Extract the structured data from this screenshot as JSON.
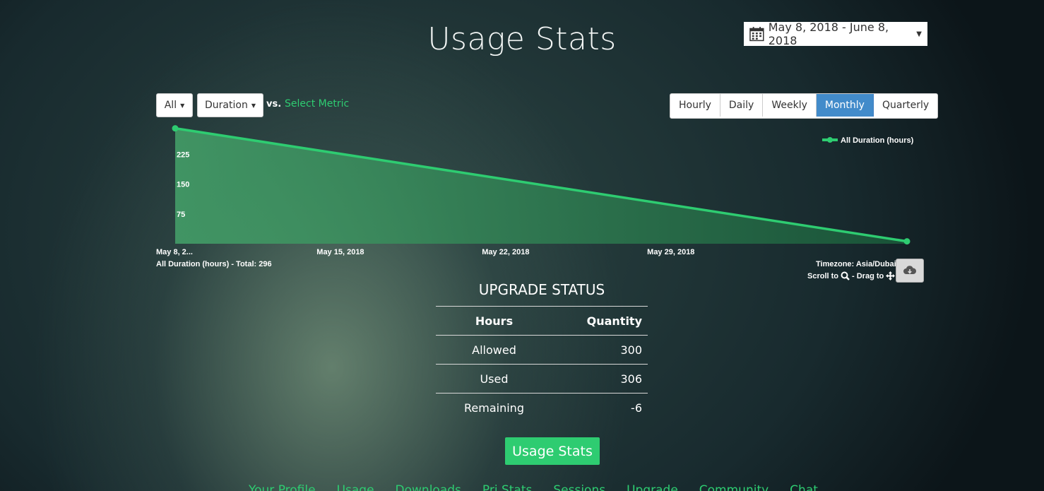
{
  "header": {
    "title": "Usage Stats",
    "date_range": "May 8, 2018 - June 8, 2018"
  },
  "filters": {
    "all_label": "All",
    "duration_label": "Duration",
    "vs_label": "vs.",
    "select_metric": "Select Metric"
  },
  "periods": [
    {
      "label": "Hourly",
      "active": false
    },
    {
      "label": "Daily",
      "active": false
    },
    {
      "label": "Weekly",
      "active": false
    },
    {
      "label": "Monthly",
      "active": true
    },
    {
      "label": "Quarterly",
      "active": false
    }
  ],
  "chart_data": {
    "type": "area",
    "series": [
      {
        "name": "All Duration (hours)",
        "values": [
          290,
          6
        ]
      }
    ],
    "x": [
      "May 8, 2018",
      "June 8, 2018"
    ],
    "x_tick_labels": [
      "May 8, 2...",
      "May 15, 2018",
      "May 22, 2018",
      "May 29, 2018"
    ],
    "x_tick_dates": [
      "2018-05-08",
      "2018-05-15",
      "2018-05-22",
      "2018-05-29"
    ],
    "y_tick_labels": [
      "75",
      "150",
      "225"
    ],
    "y_ticks": [
      75,
      150,
      225
    ],
    "ylim": [
      0,
      300
    ],
    "legend_position": "top-right",
    "grid": false,
    "line_color": "#2ecc71",
    "fill_color": "#2e8a55"
  },
  "chart_info": {
    "total": "All Duration (hours) - Total: 296",
    "timezone": "Timezone: Asia/Dubai",
    "scroll_label": "Scroll to",
    "drag_label": "- Drag to"
  },
  "upgrade": {
    "title": "UPGRADE STATUS",
    "headers": [
      "Hours",
      "Quantity"
    ],
    "rows": [
      {
        "label": "Allowed",
        "value": "300"
      },
      {
        "label": "Used",
        "value": "306"
      },
      {
        "label": "Remaining",
        "value": "-6"
      }
    ]
  },
  "usage_button": "Usage Stats",
  "bottom_nav": [
    "Your Profile",
    "Usage",
    "Downloads",
    "Pri Stats",
    "Sessions",
    "Upgrade",
    "Community",
    "Chat"
  ],
  "colors": {
    "accent": "#2ecc71",
    "active_tab": "#428bca"
  }
}
